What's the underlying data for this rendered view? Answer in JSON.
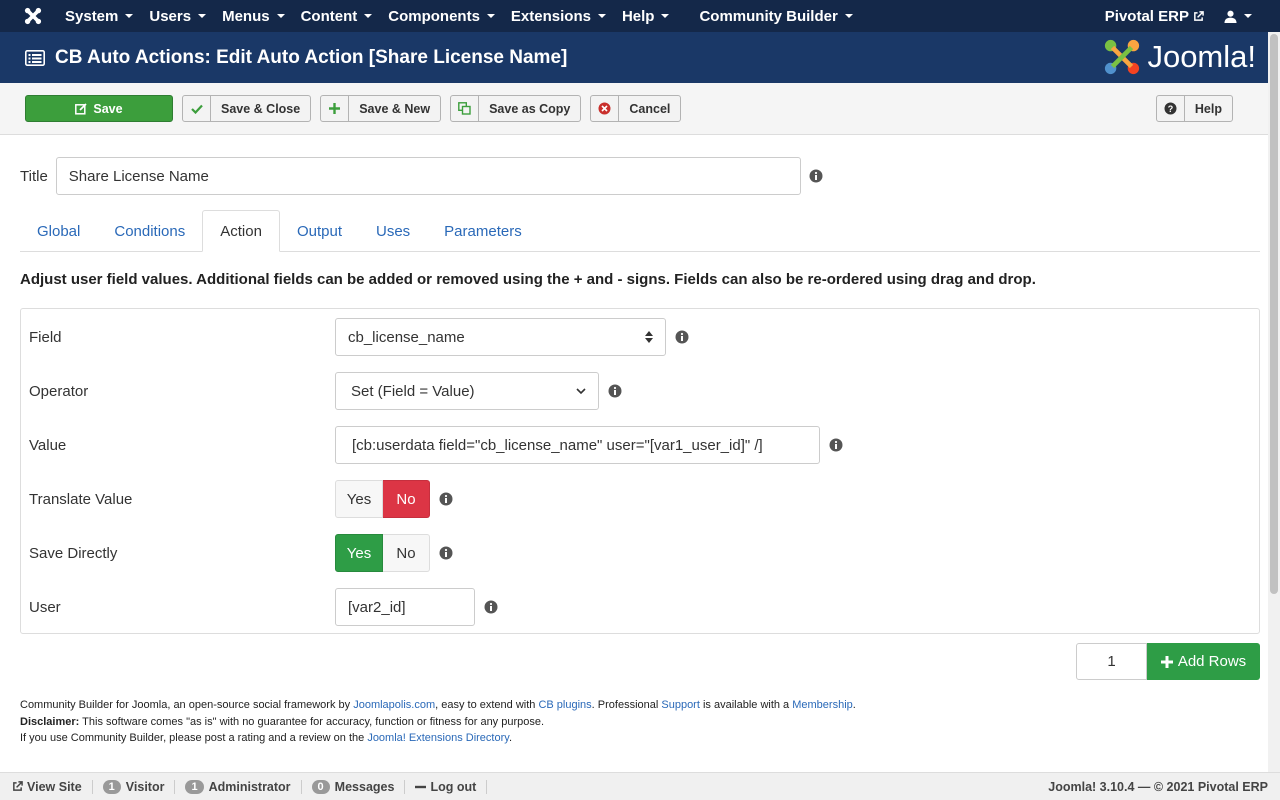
{
  "topnav": {
    "items": [
      {
        "label": "System"
      },
      {
        "label": "Users"
      },
      {
        "label": "Menus"
      },
      {
        "label": "Content"
      },
      {
        "label": "Components"
      },
      {
        "label": "Extensions"
      },
      {
        "label": "Help"
      },
      {
        "label": "Community Builder"
      }
    ],
    "site_name": "Pivotal ERP"
  },
  "header": {
    "title": "CB Auto Actions: Edit Auto Action [Share License Name]",
    "logo_text": "Joomla!"
  },
  "toolbar": {
    "save": "Save",
    "save_close": "Save & Close",
    "save_new": "Save & New",
    "save_copy": "Save as Copy",
    "cancel": "Cancel",
    "help": "Help"
  },
  "form": {
    "title_label": "Title",
    "title_value": "Share License Name"
  },
  "tabs": [
    {
      "label": "Global"
    },
    {
      "label": "Conditions"
    },
    {
      "label": "Action"
    },
    {
      "label": "Output"
    },
    {
      "label": "Uses"
    },
    {
      "label": "Parameters"
    }
  ],
  "active_tab": "Action",
  "description": "Adjust user field values. Additional fields can be added or removed using the + and - signs. Fields can also be re-ordered using drag and drop.",
  "fields": {
    "field_label": "Field",
    "field_value": "cb_license_name",
    "operator_label": "Operator",
    "operator_value": "Set (Field = Value)",
    "value_label": "Value",
    "value_value": "[cb:userdata field=\"cb_license_name\" user=\"[var1_user_id]\" /]",
    "translate_label": "Translate Value",
    "save_label": "Save Directly",
    "user_label": "User",
    "user_value": "[var2_id]",
    "yes": "Yes",
    "no": "No"
  },
  "add_rows": {
    "count": "1",
    "label": "Add Rows"
  },
  "notes": {
    "line1_a": "Community Builder for Joomla, an open-source social framework by ",
    "line1_link1": "Joomlapolis.com",
    "line1_b": ", easy to extend with ",
    "line1_link2": "CB plugins",
    "line1_c": ". Professional ",
    "line1_link3": "Support",
    "line1_d": " is available with a ",
    "line1_link4": "Membership",
    "line1_e": ".",
    "disclaimer_label": "Disclaimer:",
    "disclaimer_text": " This software comes \"as is\" with no guarantee for accuracy, function or fitness for any purpose.",
    "line3_a": "If you use Community Builder, please post a rating and a review on the ",
    "line3_link": "Joomla! Extensions Directory",
    "line3_b": "."
  },
  "statusbar": {
    "view_site": "View Site",
    "visitor_count": "1",
    "visitor": "Visitor",
    "admin_count": "1",
    "admin": "Administrator",
    "messages_count": "0",
    "messages": "Messages",
    "logout": "Log out",
    "version": "Joomla! 3.10.4 — © 2021 Pivotal ERP"
  },
  "colors": {
    "navbar": "#142849",
    "header": "#1a3867",
    "save_green": "#3c9e3c",
    "no_red": "#dc3545",
    "yes_green": "#2e9d46",
    "link_blue": "#2a69b8"
  }
}
